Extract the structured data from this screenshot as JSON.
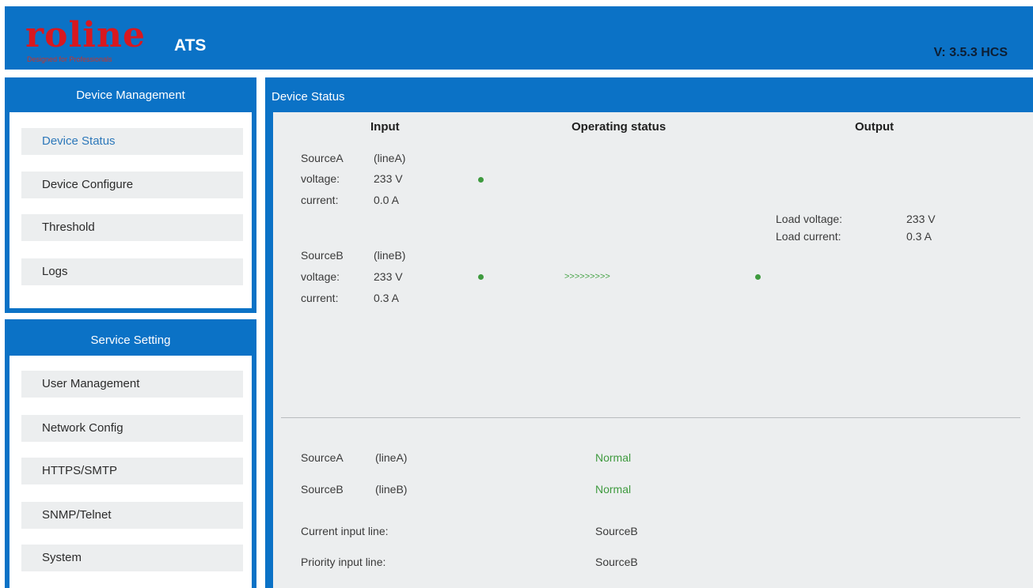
{
  "header": {
    "logo_text": "roline",
    "logo_tagline": "Designed for Professionals",
    "app_title": "ATS",
    "version": "V: 3.5.3 HCS"
  },
  "sidebar": {
    "device_management": {
      "title": "Device Management",
      "items": [
        {
          "label": "Device Status",
          "active": true
        },
        {
          "label": "Device Configure"
        },
        {
          "label": "Threshold"
        },
        {
          "label": "Logs"
        }
      ]
    },
    "service_setting": {
      "title": "Service Setting",
      "items": [
        {
          "label": "User Management"
        },
        {
          "label": "Network Config"
        },
        {
          "label": "HTTPS/SMTP"
        },
        {
          "label": "SNMP/Telnet"
        },
        {
          "label": "System"
        }
      ]
    }
  },
  "main": {
    "title": "Device Status",
    "columns": {
      "input": "Input",
      "operating": "Operating status",
      "output": "Output"
    },
    "source_a": {
      "name": "SourceA",
      "line": "(lineA)",
      "voltage_label": "voltage:",
      "voltage": "233 V",
      "current_label": "current:",
      "current": "0.0 A"
    },
    "source_b": {
      "name": "SourceB",
      "line": "(lineB)",
      "voltage_label": "voltage:",
      "voltage": "233 V",
      "current_label": "current:",
      "current": "0.3 A"
    },
    "flow_indicator": ">>>>>>>>>",
    "output": {
      "load_voltage_label": "Load voltage:",
      "load_voltage": "233 V",
      "load_current_label": "Load current:",
      "load_current": "0.3 A"
    },
    "status": {
      "source_a_name": "SourceA",
      "source_a_line": "(lineA)",
      "source_a_state": "Normal",
      "source_b_name": "SourceB",
      "source_b_line": "(lineB)",
      "source_b_state": "Normal",
      "current_input_label": "Current input line:",
      "current_input_value": "SourceB",
      "priority_input_label": "Priority input line:",
      "priority_input_value": "SourceB"
    },
    "colors": {
      "accent": "#0b72c6",
      "ok": "#3e9a3e"
    }
  }
}
